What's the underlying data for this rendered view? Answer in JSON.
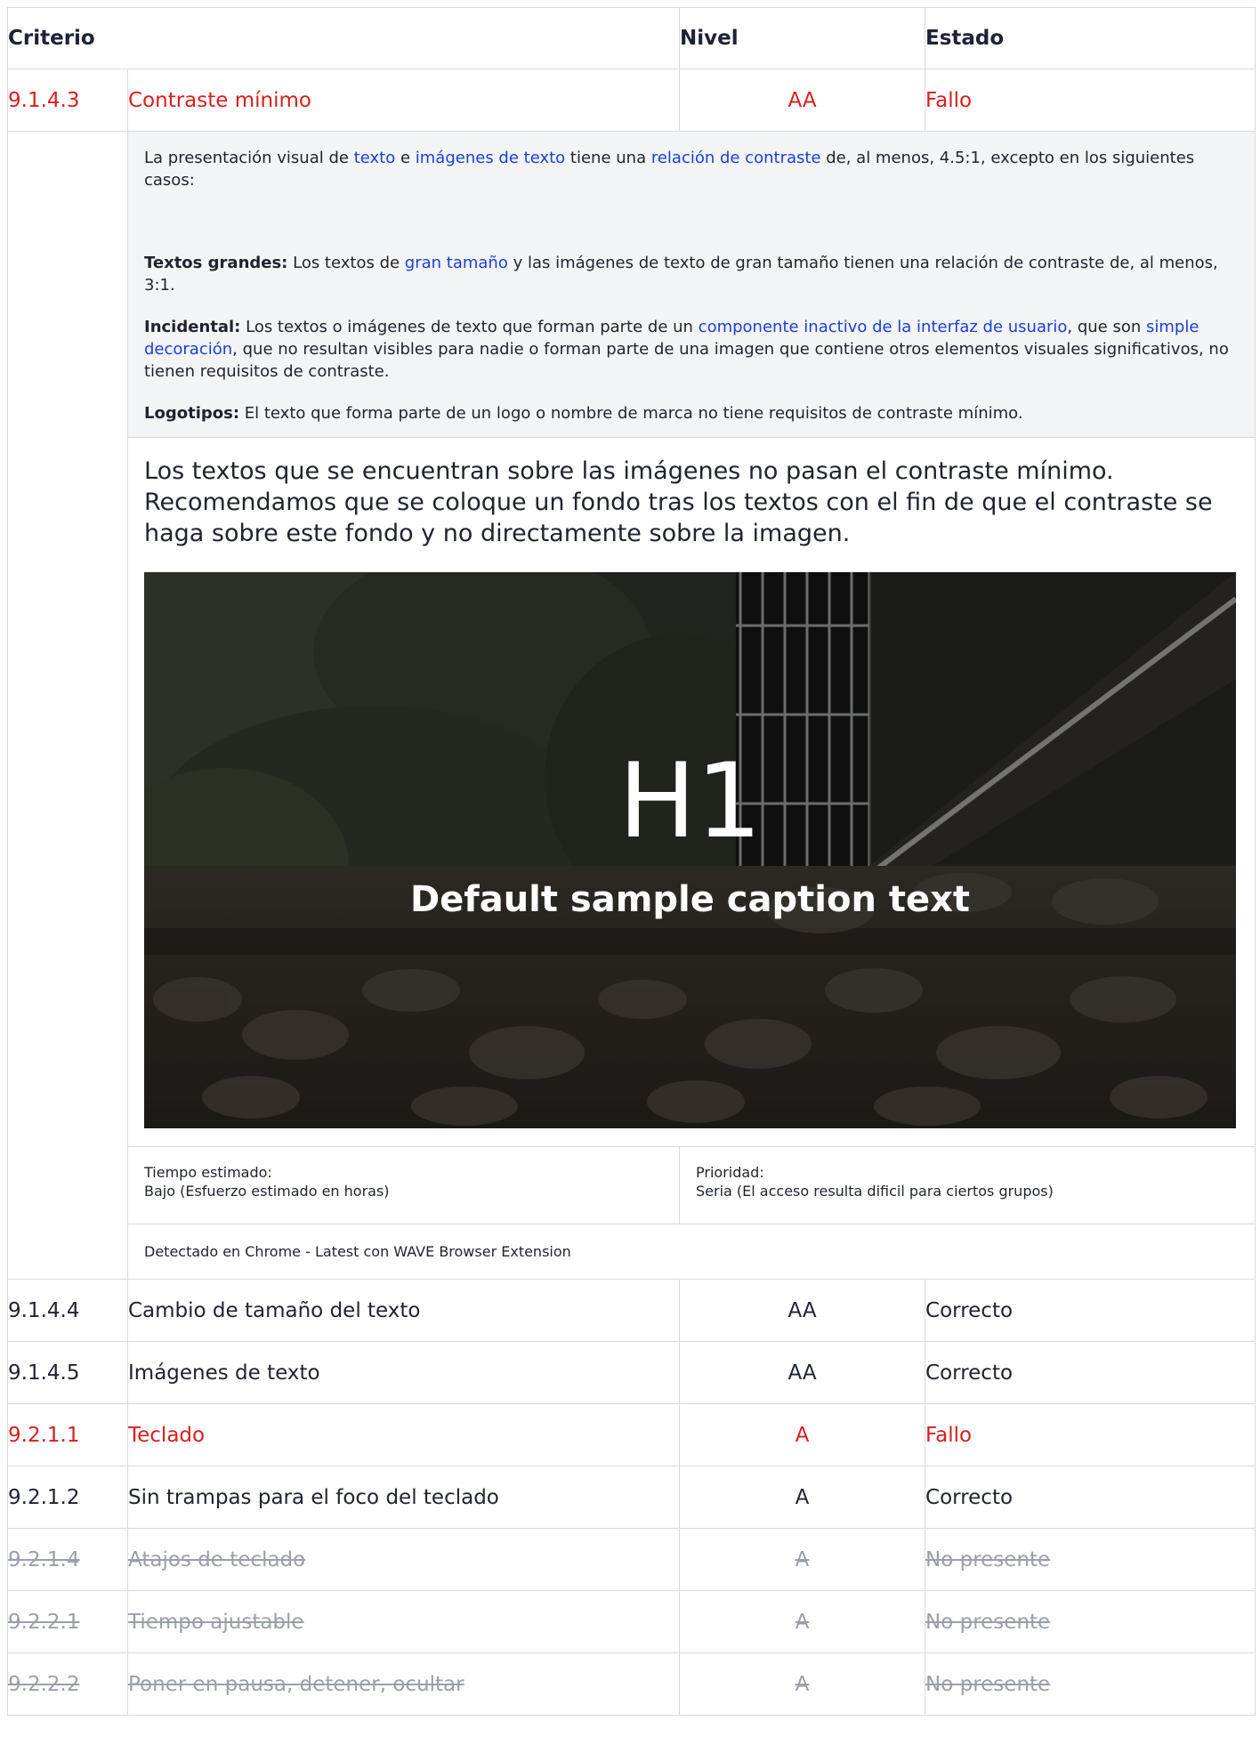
{
  "header": {
    "col1": "Criterio",
    "col2": "Nivel",
    "col3": "Estado"
  },
  "expanded": {
    "id": "9.1.4.3",
    "name": "Contraste mínimo",
    "level": "AA",
    "status": "Fallo",
    "definition": {
      "intro": {
        "t1": "La presentación visual de ",
        "l1": "texto",
        "t2": " e ",
        "l2": "imágenes de texto",
        "t3": " tiene una ",
        "l3": "relación de contraste",
        "t4": " de, al menos, 4.5:1, excepto en los siguientes casos:"
      },
      "large": {
        "label": "Textos grandes:",
        "t1": " Los textos de ",
        "l1": "gran tamaño",
        "t2": " y las imágenes de texto de gran tamaño tienen una relación de contraste de, al menos, 3:1."
      },
      "incidental": {
        "label": "Incidental:",
        "t1": " Los textos o imágenes de texto que forman parte de un ",
        "l1": "componente inactivo de la interfaz de usuario",
        "t2": ", que son ",
        "l2": "simple decoración",
        "t3": ", que no resultan visibles para nadie o forman parte de una imagen que contiene otros elementos visuales significativos, no tienen requisitos de contraste."
      },
      "logos": {
        "label": "Logotipos:",
        "t1": " El texto que forma parte de un logo o nombre de marca no tiene requisitos de contraste mínimo."
      }
    },
    "comment": "Los textos que se encuentran sobre las imágenes no pasan el contraste mínimo. Recomendamos que se coloque un fondo tras los textos con el fin de que el contraste se haga sobre este fondo y no directamente sobre la imagen.",
    "image": {
      "heading": "H1",
      "caption": "Default sample caption text"
    },
    "time_label": "Tiempo estimado:",
    "time_value": "Bajo (Esfuerzo estimado en horas)",
    "priority_label": "Prioridad:",
    "priority_value": "Seria (El acceso resulta dificil para ciertos grupos)",
    "detected": "Detectado en Chrome - Latest con WAVE Browser Extension"
  },
  "rows": [
    {
      "id": "9.1.4.4",
      "name": "Cambio de tamaño del texto",
      "level": "AA",
      "status": "Correcto"
    },
    {
      "id": "9.1.4.5",
      "name": "Imágenes de texto",
      "level": "AA",
      "status": "Correcto"
    },
    {
      "id": "9.2.1.1",
      "name": "Teclado",
      "level": "A",
      "status": "Fallo"
    },
    {
      "id": "9.2.1.2",
      "name": "Sin trampas para el foco del teclado",
      "level": "A",
      "status": "Correcto"
    },
    {
      "id": "9.2.1.4",
      "name": "Atajos de teclado",
      "level": "A",
      "status": "No presente"
    },
    {
      "id": "9.2.2.1",
      "name": "Tiempo ajustable",
      "level": "A",
      "status": "No presente"
    },
    {
      "id": "9.2.2.2",
      "name": "Poner en pausa, detener, ocultar",
      "level": "A",
      "status": "No presente"
    }
  ],
  "colors": {
    "fail": "#d91e1e",
    "link": "#1a3fd6",
    "absent": "#9aa0aa",
    "definition_bg": "#f3f4f6"
  }
}
